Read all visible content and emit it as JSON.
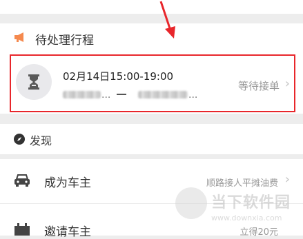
{
  "pending": {
    "title": "待处理行程",
    "icon": "megaphone-icon",
    "accent": "#f5894e"
  },
  "trip": {
    "time": "02月14日15:00-19:00",
    "from_ellipsis": "...",
    "to_ellipsis": "...",
    "status": "等待接单",
    "chevron": "›"
  },
  "discover": {
    "title": "发现",
    "icon": "compass-icon"
  },
  "rows": [
    {
      "title": "成为车主",
      "hint": "顺路接人平摊油费",
      "icon": "car-icon"
    },
    {
      "title": "邀请车主",
      "hint": "立得20元",
      "icon": "invite-icon"
    }
  ],
  "annotation_color": "#e8262b",
  "watermark": {
    "text": "当下软件园",
    "url": "www.downxia.com"
  }
}
